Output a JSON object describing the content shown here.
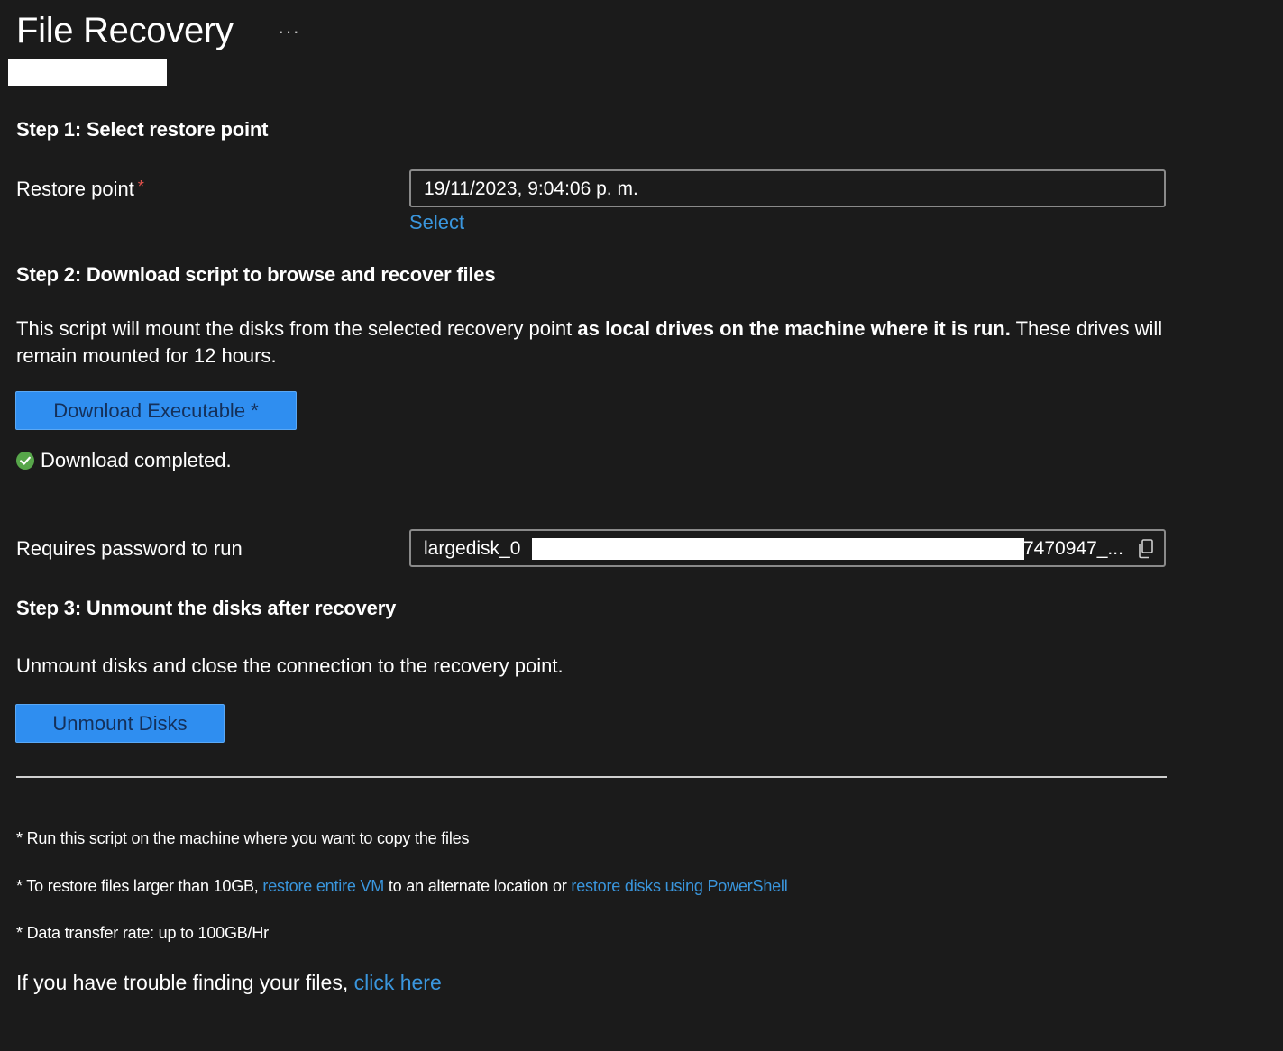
{
  "header": {
    "title": "File Recovery",
    "more_label": "···"
  },
  "step1": {
    "heading": "Step 1: Select restore point",
    "restore_point_label": "Restore point",
    "required_mark": "*",
    "restore_point_value": "19/11/2023, 9:04:06 p. m.",
    "select_link": "Select"
  },
  "step2": {
    "heading": "Step 2: Download script to browse and recover files",
    "description_part1": "This script will mount the disks from the selected recovery point ",
    "description_bold": "as local drives on the machine where it is run.",
    "description_part2": " These drives will remain mounted for 12 hours.",
    "download_button": "Download Executable *",
    "status_text": "Download completed.",
    "password_label": "Requires password to run",
    "password_prefix": "largedisk_0",
    "password_suffix": "7470947_..."
  },
  "step3": {
    "heading": "Step 3: Unmount the disks after recovery",
    "description": "Unmount disks and close the connection to the recovery point.",
    "unmount_button": "Unmount Disks"
  },
  "footnotes": {
    "note1": "* Run this script on the machine where you want to copy the files",
    "note2_part1": "* To restore files larger than 10GB, ",
    "note2_link1": "restore entire VM",
    "note2_part2": " to an alternate location or ",
    "note2_link2": "restore disks using PowerShell",
    "note3": "* Data transfer rate: up to 100GB/Hr",
    "trouble_text": "If you have trouble finding your files, ",
    "trouble_link": "click here"
  },
  "colors": {
    "background": "#1b1b1b",
    "accent_button": "#2f8ef0",
    "link": "#3a96dd",
    "success": "#57a64a",
    "required": "#e3524c"
  },
  "icons": {
    "more": "ellipsis-icon",
    "status": "check-circle-icon",
    "copy": "copy-icon"
  }
}
